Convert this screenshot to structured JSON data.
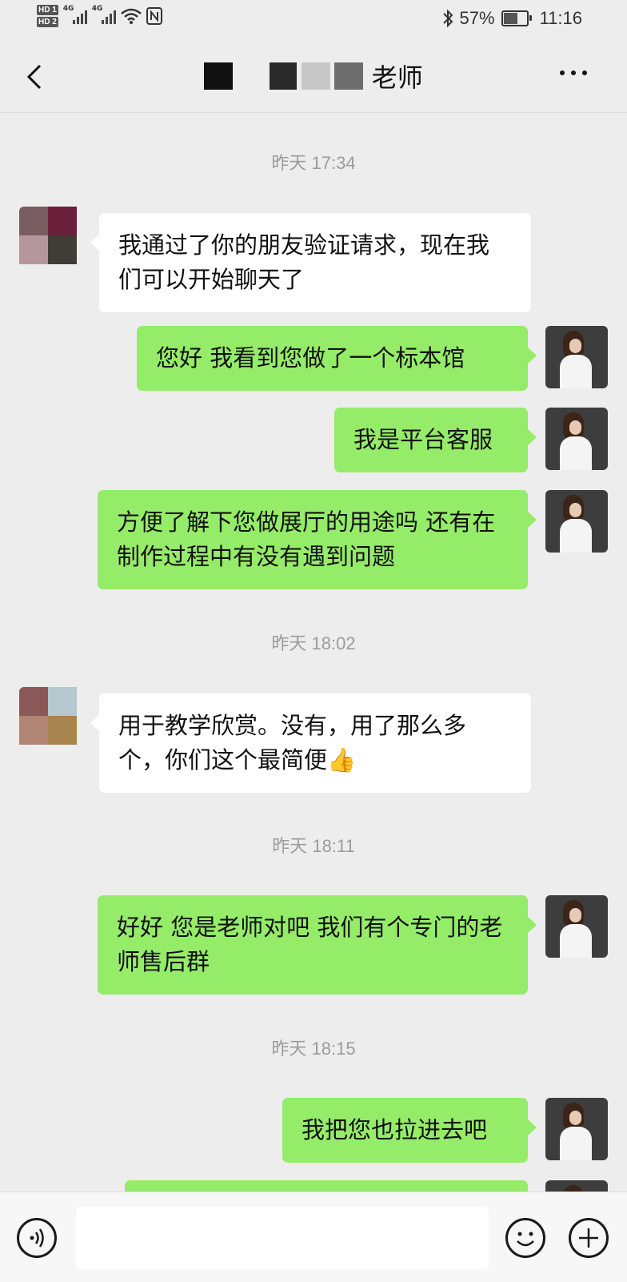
{
  "status_bar": {
    "left_indicators": [
      "HD 1",
      "HD 2",
      "4G",
      "4G"
    ],
    "battery_percent": "57%",
    "time": "11:16",
    "icons": [
      "bluetooth-icon",
      "wifi-icon",
      "nfc-icon",
      "battery-icon"
    ]
  },
  "header": {
    "title_suffix": "老师",
    "back_icon": "chevron-left-icon",
    "more_icon": "more-dots-icon"
  },
  "messages": [
    {
      "type": "timestamp",
      "text": "昨天 17:34"
    },
    {
      "type": "in",
      "text": "我通过了你的朋友验证请求，现在我们可以开始聊天了"
    },
    {
      "type": "out",
      "text": "您好  我看到您做了一个标本馆"
    },
    {
      "type": "out",
      "text": "我是平台客服"
    },
    {
      "type": "out",
      "text": "方便了解下您做展厅的用途吗  还有在制作过程中有没有遇到问题"
    },
    {
      "type": "timestamp",
      "text": "昨天 18:02"
    },
    {
      "type": "in",
      "text": "用于教学欣赏。没有，用了那么多个，你们这个最简便👍"
    },
    {
      "type": "timestamp",
      "text": "昨天 18:11"
    },
    {
      "type": "out",
      "text": "好好  您是老师对吧  我们有个专门的老师售后群"
    },
    {
      "type": "timestamp",
      "text": "昨天 18:15"
    },
    {
      "type": "out",
      "text": "我把您也拉进去吧"
    }
  ],
  "input_bar": {
    "input_value": "",
    "voice_icon": "voice-icon",
    "emoji_icon": "emoji-icon",
    "plus_icon": "plus-icon"
  },
  "colors": {
    "background": "#ededed",
    "outgoing_bubble": "#95ec69",
    "incoming_bubble": "#ffffff",
    "timestamp_text": "#9b9b9b"
  }
}
